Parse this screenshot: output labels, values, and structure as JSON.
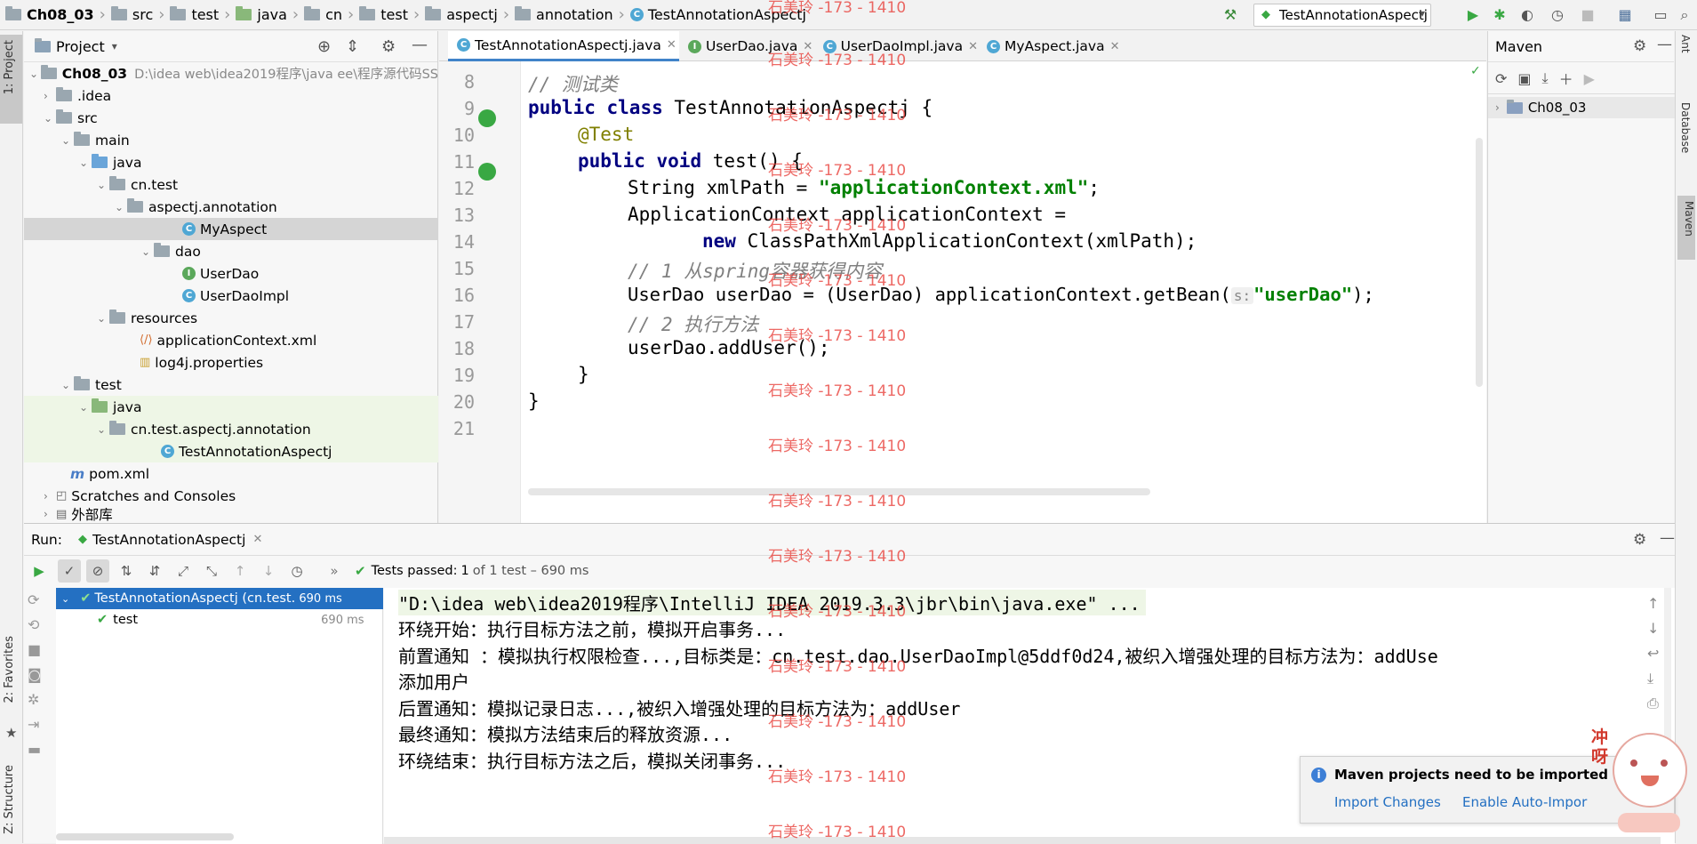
{
  "navbar": {
    "breadcrumbs": [
      "Ch08_03",
      "src",
      "test",
      "java",
      "cn",
      "test",
      "aspectj",
      "annotation",
      "TestAnnotationAspectj"
    ],
    "run_config": "TestAnnotationAspectj"
  },
  "left_strip": {
    "project_tab": "1: Project",
    "favorites_tab": "2: Favorites",
    "structure_tab": "Z: Structure"
  },
  "right_strip": {
    "ant_tab": "Ant",
    "database_tab": "Database",
    "maven_tab": "Maven"
  },
  "project": {
    "title": "Project",
    "root": "Ch08_03",
    "root_path": "D:\\idea web\\idea2019程序\\java ee\\程序源代码SS",
    "items": [
      "Ch08_03",
      ".idea",
      "src",
      "main",
      "java",
      "cn.test",
      "aspectj.annotation",
      "MyAspect",
      "dao",
      "UserDao",
      "UserDaoImpl",
      "resources",
      "applicationContext.xml",
      "log4j.properties",
      "test",
      "java",
      "cn.test.aspectj.annotation",
      "TestAnnotationAspectj",
      "pom.xml",
      "Scratches and Consoles",
      "外部库"
    ]
  },
  "editor": {
    "tabs": [
      "TestAnnotationAspectj.java",
      "UserDao.java",
      "UserDaoImpl.java",
      "MyAspect.java"
    ],
    "line_numbers": [
      "8",
      "9",
      "10",
      "11",
      "12",
      "13",
      "14",
      "15",
      "16",
      "17",
      "18",
      "19",
      "20",
      "21"
    ],
    "code": {
      "l8_comment": "// 测试类",
      "l9_kw1": "public",
      "l9_kw2": "class",
      "l9_rest": " TestAnnotationAspectj {",
      "l10_ann": "@Test",
      "l11_kw1": "public",
      "l11_kw2": "void",
      "l11_rest": " test() {",
      "l12_a": "String xmlPath = ",
      "l12_str": "\"applicationContext.xml\"",
      "l12_b": ";",
      "l13": "ApplicationContext applicationContext =",
      "l14_kw": "new",
      "l14_rest": " ClassPathXmlApplicationContext(xmlPath);",
      "l15_comment": "// 1 从spring容器获得内容",
      "l16_a": "UserDao userDao = (UserDao) applicationContext.getBean(",
      "l16_hint": "s:",
      "l16_str": "\"userDao\"",
      "l16_b": ");",
      "l17_comment": "// 2 执行方法",
      "l18": "userDao.addUser();",
      "l19": "}",
      "l20": "}"
    }
  },
  "maven": {
    "title": "Maven",
    "project": "Ch08_03"
  },
  "run": {
    "label": "Run:",
    "tab": "TestAnnotationAspectj",
    "status_prefix": "Tests passed:",
    "status_count": "1",
    "status_suffix": "of 1 test – 690 ms",
    "tree": [
      {
        "name": "TestAnnotationAspectj (cn.test.aspe",
        "time": "690 ms"
      },
      {
        "name": "test",
        "time": "690 ms"
      }
    ],
    "console": [
      "\"D:\\idea web\\idea2019程序\\IntelliJ IDEA 2019.3.3\\jbr\\bin\\java.exe\" ...",
      "环绕开始：执行目标方法之前，模拟开启事务...",
      "前置通知 ：模拟执行权限检查...,目标类是：cn.test.dao.UserDaoImpl@5ddf0d24,被织入增强处理的目标方法为：addUse",
      "添加用户",
      "后置通知：模拟记录日志...,被织入增强处理的目标方法为：addUser",
      "最终通知：模拟方法结束后的释放资源...",
      "环绕结束：执行目标方法之后，模拟关闭事务..."
    ]
  },
  "notification": {
    "title": "Maven projects need to be imported",
    "action1": "Import Changes",
    "action2": "Enable Auto-Impor"
  },
  "watermark": "石美玲 -173 - 1410",
  "sticker_text": "冲呀"
}
